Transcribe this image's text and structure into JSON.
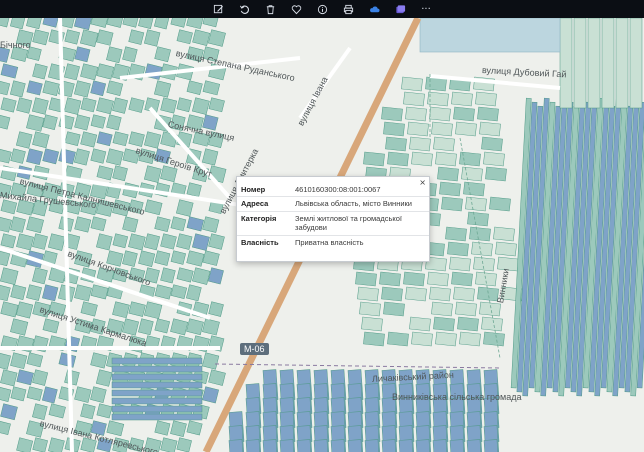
{
  "toolbar": {
    "icons": [
      "edit-icon",
      "rotate-icon",
      "trash-icon",
      "heart-icon",
      "info-icon",
      "print-icon",
      "cloud-icon",
      "photo-stack-icon",
      "more-icon"
    ],
    "more_label": "···"
  },
  "map": {
    "colors": {
      "background": "#eef0ec",
      "parcel_fill": "#9cc9bc",
      "parcel_stroke": "#4f9a86",
      "parcel_blue": "#7fa3c8",
      "field_fill": "#c9e0d4",
      "main_road": "#d8a77a",
      "side_road": "#ffffff",
      "water": "#bcd6df"
    },
    "streets": [
      "вулиця Степана Руданського",
      "вулиця Івана",
      "вулиця Дубовий Гай",
      "Сонячна вулиця",
      "вулиця Героїв Крут",
      "вулиця Дмитерка",
      "вулиця Петра Калнишевського",
      "Михайла Грушевського",
      "вулиця Корчовського",
      "вулиця Устима Кармалюка",
      "вулиця Івана Котляревського",
      "Личаківський район",
      "Винниківська сільська громада",
      "Винники",
      "Бічного"
    ],
    "road_badge": "М-06"
  },
  "popup": {
    "close_symbol": "×",
    "rows": [
      {
        "key": "Номер",
        "value": "4610160300:08:001:0067"
      },
      {
        "key": "Адреса",
        "value": "Львівська область, місто Винники"
      },
      {
        "key": "Категорія",
        "value": "Землі житлової та громадської забудови"
      },
      {
        "key": "Власність",
        "value": "Приватна власність"
      }
    ]
  }
}
